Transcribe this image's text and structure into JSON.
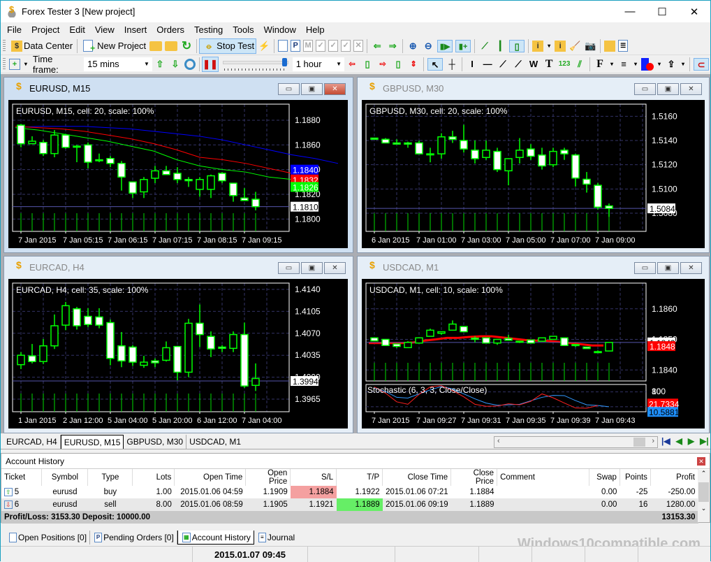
{
  "window": {
    "title": "Forex Tester 3  [New project]",
    "minimize_label": "—",
    "maximize_label": "☐",
    "close_label": "✕"
  },
  "menu": [
    "File",
    "Project",
    "Edit",
    "View",
    "Insert",
    "Orders",
    "Testing",
    "Tools",
    "Window",
    "Help"
  ],
  "toolbar1": {
    "data_center": "Data Center",
    "new_project": "New Project",
    "stop_test": "Stop Test"
  },
  "toolbar2": {
    "timeframe_label": "Time frame:",
    "timeframe_value": "15 mins",
    "speed_value": "1 hour",
    "speed_slider_fraction": 0.96
  },
  "charts": [
    {
      "id": "eurusd",
      "window_title": "EURUSD, M15",
      "info": "EURUSD, M15, cell: 20, scale: 100%",
      "active": true,
      "ylim": [
        1.179,
        1.1893
      ],
      "yticks": [
        "1.1880",
        "1.1860",
        "1.1840",
        "1.1820",
        "1.1800"
      ],
      "ytick_values": [
        1.188,
        1.186,
        1.184,
        1.182,
        1.18
      ],
      "xticks": [
        "7 Jan 2015",
        "7 Jan 05:15",
        "7 Jan 06:15",
        "7 Jan 07:15",
        "7 Jan 08:15",
        "7 Jan 09:15"
      ],
      "price_line": 1.181,
      "labels": [
        {
          "text": "1.1840",
          "value": 1.184,
          "bg": "#0000ff",
          "fg": "#ffffff"
        },
        {
          "text": "1.1832",
          "value": 1.1832,
          "bg": "#ff0000",
          "fg": "#ffffff"
        },
        {
          "text": "1.1826",
          "value": 1.1826,
          "bg": "#00ff00",
          "fg": "#ffffff"
        },
        {
          "text": "1.1810",
          "value": 1.181,
          "bg": "#ffffff",
          "fg": "#000000"
        }
      ],
      "candles": [
        [
          1.1876,
          1.1877,
          1.1858,
          1.1861
        ],
        [
          1.1861,
          1.1867,
          1.1861,
          1.1863
        ],
        [
          1.1862,
          1.1864,
          1.1851,
          1.1853
        ],
        [
          1.1853,
          1.1872,
          1.185,
          1.1868
        ],
        [
          1.1868,
          1.1869,
          1.1857,
          1.1858
        ],
        [
          1.1859,
          1.186,
          1.1846,
          1.1859
        ],
        [
          1.186,
          1.1862,
          1.1841,
          1.1846
        ],
        [
          1.1848,
          1.1853,
          1.1846,
          1.1848
        ],
        [
          1.1849,
          1.1851,
          1.1842,
          1.1845
        ],
        [
          1.1845,
          1.1847,
          1.1823,
          1.1834
        ],
        [
          1.183,
          1.183,
          1.1817,
          1.1821
        ],
        [
          1.1822,
          1.1834,
          1.1817,
          1.1832
        ],
        [
          1.1833,
          1.1843,
          1.1829,
          1.1839
        ],
        [
          1.1839,
          1.1843,
          1.1836,
          1.1836
        ],
        [
          1.1837,
          1.1842,
          1.1829,
          1.1832
        ],
        [
          1.1832,
          1.1834,
          1.1826,
          1.1831
        ],
        [
          1.1824,
          1.1834,
          1.1818,
          1.1832
        ],
        [
          1.1824,
          1.1836,
          1.1817,
          1.1835
        ],
        [
          1.1837,
          1.1838,
          1.1829,
          1.1831
        ],
        [
          1.1829,
          1.1829,
          1.1814,
          1.1819
        ],
        [
          1.1817,
          1.1825,
          1.1815,
          1.1815
        ],
        [
          1.1816,
          1.1822,
          1.1807,
          1.181
        ]
      ],
      "lines": [
        {
          "color": "#0000ff",
          "values": [
            1.1874,
            1.1875,
            1.1875,
            1.1875,
            1.1874,
            1.1873,
            1.1871,
            1.1869,
            1.1867,
            1.1864,
            1.186,
            1.1856,
            1.1852,
            1.1849,
            1.1845
          ]
        },
        {
          "color": "#ff0000",
          "values": [
            1.1875,
            1.1874,
            1.1873,
            1.1871,
            1.1868,
            1.1865,
            1.1861,
            1.1856,
            1.185,
            1.1848,
            1.1845,
            1.1841,
            1.1837,
            1.1833
          ]
        },
        {
          "color": "#00ff00",
          "values": [
            1.1874,
            1.1872,
            1.1869,
            1.1866,
            1.1863,
            1.1859,
            1.1855,
            1.1848,
            1.1843,
            1.184,
            1.1838,
            1.1834,
            1.1832,
            1.1826
          ]
        }
      ]
    },
    {
      "id": "gbpusd",
      "window_title": "GBPUSD, M30",
      "info": "GBPUSD, M30, cell: 20, scale: 100%",
      "active": false,
      "ylim": [
        1.5065,
        1.517
      ],
      "yticks": [
        "1.5160",
        "1.5140",
        "1.5120",
        "1.5100",
        "1.5080"
      ],
      "ytick_values": [
        1.516,
        1.514,
        1.512,
        1.51,
        1.508
      ],
      "xticks": [
        "6 Jan 2015",
        "7 Jan 01:00",
        "7 Jan 03:00",
        "7 Jan 05:00",
        "7 Jan 07:00",
        "7 Jan 09:00"
      ],
      "price_line": 1.5084,
      "labels": [
        {
          "text": "1.5084",
          "value": 1.5084,
          "bg": "#ffffff",
          "fg": "#000000"
        }
      ],
      "candles": [
        [
          1.5142,
          1.5142,
          1.5141,
          1.5141
        ],
        [
          1.5141,
          1.5142,
          1.5138,
          1.5138
        ],
        [
          1.5138,
          1.5141,
          1.5137,
          1.5137
        ],
        [
          1.5138,
          1.5139,
          1.5134,
          1.5137
        ],
        [
          1.5138,
          1.514,
          1.5129,
          1.5129
        ],
        [
          1.5129,
          1.5134,
          1.5122,
          1.5129
        ],
        [
          1.5129,
          1.5146,
          1.5125,
          1.5143
        ],
        [
          1.5143,
          1.5148,
          1.5138,
          1.5141
        ],
        [
          1.514,
          1.5153,
          1.513,
          1.5133
        ],
        [
          1.5132,
          1.514,
          1.5121,
          1.5125
        ],
        [
          1.5126,
          1.514,
          1.5124,
          1.5132
        ],
        [
          1.5131,
          1.5134,
          1.5114,
          1.5116
        ],
        [
          1.5115,
          1.5125,
          1.5103,
          1.5125
        ],
        [
          1.5126,
          1.5142,
          1.5121,
          1.5132
        ],
        [
          1.5133,
          1.5137,
          1.5124,
          1.5127
        ],
        [
          1.5128,
          1.5134,
          1.5116,
          1.5119
        ],
        [
          1.512,
          1.5134,
          1.5118,
          1.5131
        ],
        [
          1.5132,
          1.5134,
          1.5124,
          1.5129
        ],
        [
          1.5128,
          1.5129,
          1.5102,
          1.5109
        ],
        [
          1.5108,
          1.5114,
          1.5097,
          1.5104
        ],
        [
          1.5103,
          1.5105,
          1.5083,
          1.5085
        ],
        [
          1.5086,
          1.5088,
          1.5077,
          1.5084
        ]
      ]
    },
    {
      "id": "eurcad",
      "window_title": "EURCAD, H4",
      "info": "EURCAD, H4, cell: 35, scale: 100%",
      "active": false,
      "ylim": [
        1.3945,
        1.415
      ],
      "yticks": [
        "1.4140",
        "1.4105",
        "1.4070",
        "1.4035",
        "1.4000",
        "1.3965"
      ],
      "ytick_values": [
        1.414,
        1.4105,
        1.407,
        1.4035,
        1.4,
        1.3965
      ],
      "xticks": [
        "1 Jan 2015",
        "2 Jan 12:00",
        "5 Jan 04:00",
        "5 Jan 20:00",
        "6 Jan 12:00",
        "7 Jan 04:00"
      ],
      "price_line": 1.3994,
      "labels": [
        {
          "text": "1.3994",
          "value": 1.3994,
          "bg": "#ffffff",
          "fg": "#000000"
        }
      ],
      "candles": [
        [
          1.402,
          1.404,
          1.4013,
          1.4035
        ],
        [
          1.4034,
          1.4053,
          1.4022,
          1.4025
        ],
        [
          1.4025,
          1.4061,
          1.4021,
          1.405
        ],
        [
          1.405,
          1.41,
          1.4045,
          1.4082
        ],
        [
          1.4083,
          1.412,
          1.4075,
          1.4114
        ],
        [
          1.4109,
          1.4112,
          1.4076,
          1.4082
        ],
        [
          1.4097,
          1.411,
          1.408,
          1.4084
        ],
        [
          1.4096,
          1.411,
          1.4078,
          1.4083
        ],
        [
          1.4087,
          1.4092,
          1.4019,
          1.403
        ],
        [
          1.405,
          1.4072,
          1.4016,
          1.4026
        ],
        [
          1.4048,
          1.4051,
          1.4018,
          1.4024
        ],
        [
          1.4019,
          1.4034,
          1.4015,
          1.4024
        ],
        [
          1.4026,
          1.403,
          1.4016,
          1.4023
        ],
        [
          1.4027,
          1.4057,
          1.4025,
          1.4047
        ],
        [
          1.4049,
          1.405,
          1.3995,
          1.4008
        ],
        [
          1.4008,
          1.4093,
          1.4,
          1.4086
        ],
        [
          1.4086,
          1.4116,
          1.4048,
          1.4068
        ],
        [
          1.4065,
          1.4073,
          1.4032,
          1.4045
        ],
        [
          1.4048,
          1.4051,
          1.404,
          1.4046
        ],
        [
          1.4046,
          1.4073,
          1.404,
          1.4068
        ],
        [
          1.4068,
          1.4087,
          1.3983,
          1.3986
        ],
        [
          1.3987,
          1.4022,
          1.3978,
          1.3998
        ]
      ]
    },
    {
      "id": "usdcad",
      "window_title": "USDCAD, M1",
      "info": "USDCAD, M1, cell: 10, scale: 100%",
      "active": false,
      "ylim": [
        1.18364,
        1.18684
      ],
      "yticks": [
        "1.1860",
        "1.1850",
        "1.1840"
      ],
      "ytick_values": [
        1.186,
        1.185,
        1.184
      ],
      "xticks": [
        "7 Jan 2015",
        "7 Jan 09:27",
        "7 Jan 09:31",
        "7 Jan 09:35",
        "7 Jan 09:39",
        "7 Jan 09:43"
      ],
      "price_line": 1.1849,
      "labels": [
        {
          "text": "1.1849",
          "value": 1.1849,
          "bg": "#ffffff",
          "fg": "#000000"
        },
        {
          "text": "1.1848",
          "value": 1.18478,
          "bg": "#ff0000",
          "fg": "#ffffff"
        }
      ],
      "candles": [
        [
          1.18505,
          1.18505,
          1.18495,
          1.18495
        ],
        [
          1.185,
          1.185,
          1.1848,
          1.1848
        ],
        [
          1.18485,
          1.18485,
          1.18472,
          1.18477
        ],
        [
          1.18473,
          1.18494,
          1.18473,
          1.1849
        ],
        [
          1.18488,
          1.18505,
          1.18488,
          1.18505
        ],
        [
          1.1851,
          1.18535,
          1.1851,
          1.1853
        ],
        [
          1.1852,
          1.18525,
          1.18515,
          1.18525
        ],
        [
          1.1853,
          1.18562,
          1.1853,
          1.1855
        ],
        [
          1.18542,
          1.18542,
          1.18525,
          1.18525
        ],
        [
          1.18504,
          1.1851,
          1.1849,
          1.185
        ],
        [
          1.18505,
          1.18505,
          1.18488,
          1.18488
        ],
        [
          1.18488,
          1.185,
          1.18482,
          1.185
        ],
        [
          1.18503,
          1.18515,
          1.18497,
          1.18497
        ],
        [
          1.18494,
          1.18494,
          1.18488,
          1.18494
        ],
        [
          1.18498,
          1.18498,
          1.18488,
          1.18488
        ],
        [
          1.18494,
          1.18505,
          1.18494,
          1.18505
        ],
        [
          1.185,
          1.1851,
          1.185,
          1.1851
        ],
        [
          1.18505,
          1.18505,
          1.1848,
          1.1848
        ],
        [
          1.18483,
          1.18485,
          1.18475,
          1.18483
        ],
        [
          1.18475,
          1.18475,
          1.1847,
          1.1847
        ],
        [
          1.1846,
          1.18464,
          1.18456,
          1.1846
        ],
        [
          1.18462,
          1.1849,
          1.18462,
          1.1849
        ]
      ],
      "lines": [
        {
          "color": "#ff0000",
          "values": [
            1.18488,
            1.18488,
            1.18488,
            1.18488,
            1.1849,
            1.18496,
            1.185,
            1.18505,
            1.18505,
            1.18508,
            1.1851,
            1.1851,
            1.18506,
            1.18502,
            1.18498,
            1.18496,
            1.18495,
            1.18492,
            1.18488,
            1.18484,
            1.1848,
            1.1848
          ]
        }
      ],
      "stochastic": {
        "title": "Stochastic (6, 3, 3, Close/Close)",
        "labels": [
          {
            "text": "80",
            "value": 80
          },
          {
            "text": "100",
            "value": 100
          }
        ],
        "value_labels": [
          {
            "text": "21.7334",
            "value": 21.7,
            "bg": "#ff0000",
            "fg": "#ffffff"
          },
          {
            "text": "10.5881",
            "value": 10.6,
            "bg": "#1e90ff",
            "fg": "#000000"
          }
        ],
        "main": [
          100,
          75,
          40,
          30,
          70,
          100,
          105,
          85,
          60,
          30,
          22,
          23,
          32,
          28,
          42,
          72,
          56,
          35,
          15,
          14,
          25
        ],
        "signal": [
          95,
          82,
          58,
          55,
          72,
          88,
          102,
          92,
          72,
          52,
          35,
          26,
          28,
          30,
          44,
          58,
          66,
          65,
          45,
          28,
          25,
          20
        ]
      }
    }
  ],
  "chart_tabs": [
    "EURCAD, H4",
    "EURUSD, M15",
    "GBPUSD, M30",
    "USDCAD, M1"
  ],
  "account_history": {
    "title": "Account History",
    "columns": [
      "Ticket",
      "Symbol",
      "Type",
      "Lots",
      "Open Time",
      "Open Price",
      "S/L",
      "T/P",
      "Close Time",
      "Close Price",
      "Comment",
      "Swap",
      "Points",
      "Profit"
    ],
    "rows": [
      {
        "ticket": "5",
        "symbol": "eurusd",
        "type": "buy",
        "lots": "1.00",
        "open_time": "2015.01.06 04:59",
        "open_price": "1.1909",
        "sl": "1.1884",
        "tp": "1.1922",
        "close_time": "2015.01.06 07:21",
        "close_price": "1.1884",
        "comment": "",
        "swap": "0.00",
        "points": "-25",
        "profit": "-250.00"
      },
      {
        "ticket": "6",
        "symbol": "eurusd",
        "type": "sell",
        "lots": "8.00",
        "open_time": "2015.01.06 08:59",
        "open_price": "1.1905",
        "sl": "1.1921",
        "tp": "1.1889",
        "close_time": "2015.01.06 09:19",
        "close_price": "1.1889",
        "comment": "",
        "swap": "0.00",
        "points": "16",
        "profit": "1280.00"
      }
    ],
    "total_label": "Profit/Loss: 3153.30 Deposit: 10000.00",
    "total_value": "13153.30",
    "sl_hit_color": "#f4a0a0",
    "tp_hit_color": "#66ee66"
  },
  "bottom_tabs": [
    "Open Positions [0]",
    "Pending Orders [0]",
    "Account History",
    "Journal"
  ],
  "status": {
    "time": "2015.01.07 09:45"
  },
  "watermark": "Windows10compatible.com"
}
